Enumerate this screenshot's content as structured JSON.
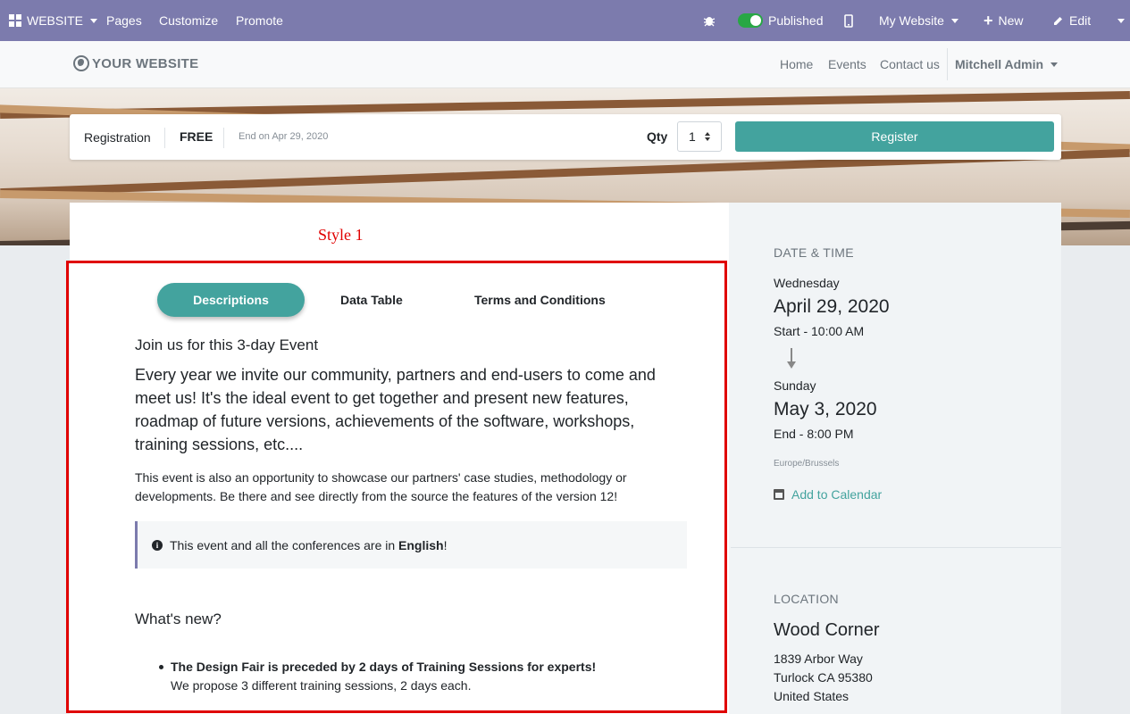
{
  "adminbar": {
    "app_label": "WEBSITE",
    "menu": [
      "Pages",
      "Customize",
      "Promote"
    ],
    "published_label": "Published",
    "website_selector": "My Website",
    "new_label": "New",
    "edit_label": "Edit"
  },
  "navbar": {
    "logo": "YOUR WEBSITE",
    "links": [
      "Home",
      "Events",
      "Contact us"
    ],
    "user": "Mitchell Admin"
  },
  "registration": {
    "label": "Registration",
    "price": "FREE",
    "end": "End on Apr 29, 2020",
    "qty_label": "Qty",
    "qty_value": "1",
    "register_label": "Register"
  },
  "annotation": "Style 1",
  "tabs": {
    "active": "Descriptions",
    "data_table": "Data Table",
    "terms": "Terms and Conditions"
  },
  "content": {
    "intro_heading": "Join us for this 3-day Event",
    "lead": "Every year we invite our community, partners and end-users to come and meet us! It's the ideal event to get together and present new features, roadmap of future versions, achievements of the software, workshops, training sessions, etc....",
    "paragraph": "This event is also an opportunity to showcase our partners' case studies, methodology or developments. Be there and see directly from the source the features of the version 12!",
    "alert_prefix": "This event and all the conferences are in ",
    "alert_bold": "English",
    "alert_suffix": "!",
    "whats_new": "What's new?",
    "bullet_title": "The Design Fair is preceded by 2 days of Training Sessions for experts!",
    "bullet_text": "We propose 3 different training sessions, 2 days each."
  },
  "sidebar": {
    "datetime_heading": "DATE & TIME",
    "start_day": "Wednesday",
    "start_date": "April 29, 2020",
    "start_time": "Start - 10:00 AM",
    "end_day": "Sunday",
    "end_date": "May 3, 2020",
    "end_time": "End - 8:00 PM",
    "timezone": "Europe/Brussels",
    "calendar_link": "Add to Calendar",
    "location_heading": "LOCATION",
    "location_name": "Wood Corner",
    "address_line1": "1839 Arbor Way",
    "address_line2": "Turlock CA 95380",
    "address_line3": "United States"
  },
  "colors": {
    "admin_bar": "#7c7bad",
    "accent": "#43a39e",
    "annotation": "#e00000"
  }
}
